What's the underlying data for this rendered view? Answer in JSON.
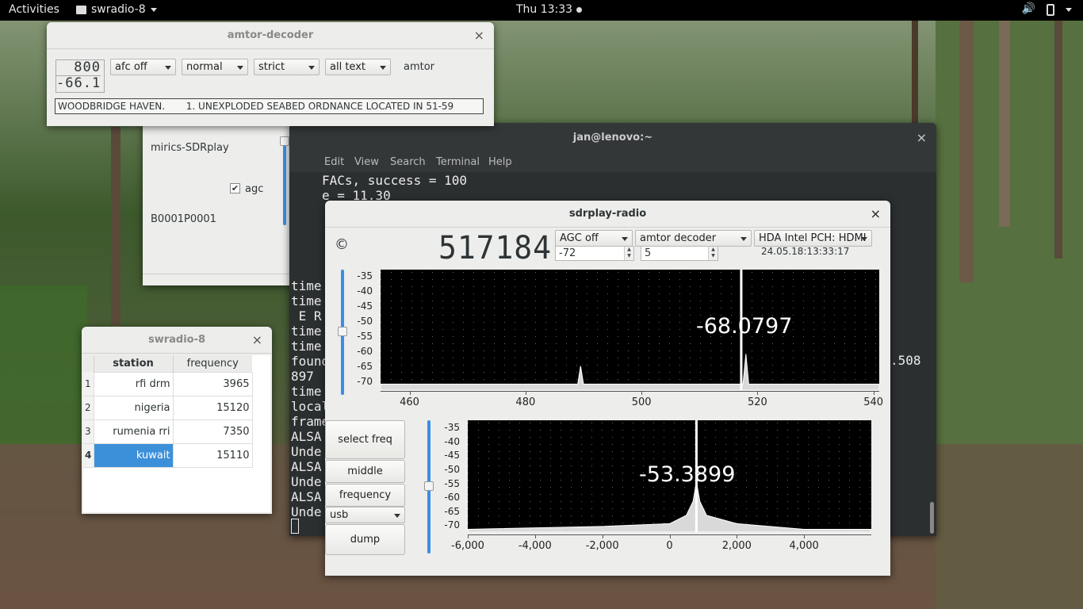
{
  "topbar": {
    "activities": "Activities",
    "app_name": "swradio-8",
    "clock": "Thu 13:33"
  },
  "amtor": {
    "title": "amtor-decoder",
    "lcd_top": "800",
    "lcd_bottom": "-66.1",
    "afc": "afc off",
    "mode": "normal",
    "strict": "strict",
    "text_filter": "all text",
    "label": "amtor",
    "message": "WOODBRIDGE HAVEN.       1. UNEXPLODED SEABED ORDNANCE LOCATED IN 51-59"
  },
  "device": {
    "name": "mirics-SDRplay",
    "agc_label": "agc",
    "serial": "B0001P0001"
  },
  "terminal": {
    "title": "jan@lenovo:~",
    "menu": [
      "Edit",
      "View",
      "Search",
      "Terminal",
      "Help"
    ],
    "lines": [
      "FACs, success = 100",
      "e = 11.30",
      "",
      "",
      "",
      "",
      "",
      "time",
      "time",
      " E R",
      "time",
      "time",
      "found",
      "897",
      "time",
      "local",
      "frame",
      "ALSA",
      "Unde",
      "ALSA",
      "Unde",
      "ALSA",
      "Unde"
    ],
    "right_text": ".508"
  },
  "swradio": {
    "title": "swradio-8",
    "col_station": "station",
    "col_frequency": "frequency",
    "rows": [
      {
        "n": "1",
        "station": "rfi drm",
        "freq": "3965"
      },
      {
        "n": "2",
        "station": "nigeria",
        "freq": "15120"
      },
      {
        "n": "3",
        "station": "rumenia rri",
        "freq": "7350"
      },
      {
        "n": "4",
        "station": "kuwait",
        "freq": "15110"
      }
    ],
    "selected_row": 4
  },
  "sdrplay": {
    "title": "sdrplay-radio",
    "copyright": "©",
    "frequency": "517184",
    "agc": "AGC off",
    "decoder": "amtor decoder",
    "audio": "HDA Intel PCH: HDMI",
    "gain": "-72",
    "lna": "5",
    "timestamp": "24.05.18:13:33:17",
    "buttons": {
      "select_freq": "select freq",
      "middle": "middle",
      "frequency_save": "frequency save",
      "mode": "usb",
      "dump": "dump"
    }
  },
  "chart_data": [
    {
      "type": "line",
      "title": "",
      "readout": "-68.0797",
      "x_ticks": [
        "460",
        "480",
        "500",
        "520",
        "540"
      ],
      "y_ticks": [
        "-35",
        "-40",
        "-45",
        "-50",
        "-55",
        "-60",
        "-65",
        "-70"
      ],
      "xlim": [
        455,
        541
      ],
      "ylim": [
        -73,
        -33
      ],
      "marker_x": 517.2,
      "series": [
        {
          "values": [
            [
              455,
              -71
            ],
            [
              470,
              -71
            ],
            [
              489,
              -71
            ],
            [
              489.5,
              -65
            ],
            [
              490,
              -71
            ],
            [
              500,
              -71
            ],
            [
              517.5,
              -71
            ],
            [
              518,
              -61
            ],
            [
              518.5,
              -71
            ],
            [
              541,
              -71
            ]
          ]
        }
      ]
    },
    {
      "type": "area",
      "title": "",
      "readout": "-53.3899",
      "x_ticks": [
        "-6,000",
        "-4,000",
        "-2,000",
        "0",
        "2,000",
        "4,000"
      ],
      "y_ticks": [
        "-35",
        "-40",
        "-45",
        "-50",
        "-55",
        "-60",
        "-65",
        "-70"
      ],
      "xlim": [
        -6000,
        6000
      ],
      "ylim": [
        -73,
        -33
      ],
      "marker_x": 800,
      "series": [
        {
          "values": [
            [
              -6000,
              -72
            ],
            [
              -2000,
              -71
            ],
            [
              0,
              -70
            ],
            [
              500,
              -67
            ],
            [
              700,
              -62
            ],
            [
              800,
              -55
            ],
            [
              900,
              -62
            ],
            [
              1100,
              -67
            ],
            [
              2000,
              -70
            ],
            [
              4000,
              -72
            ],
            [
              6000,
              -72
            ]
          ]
        }
      ]
    }
  ]
}
